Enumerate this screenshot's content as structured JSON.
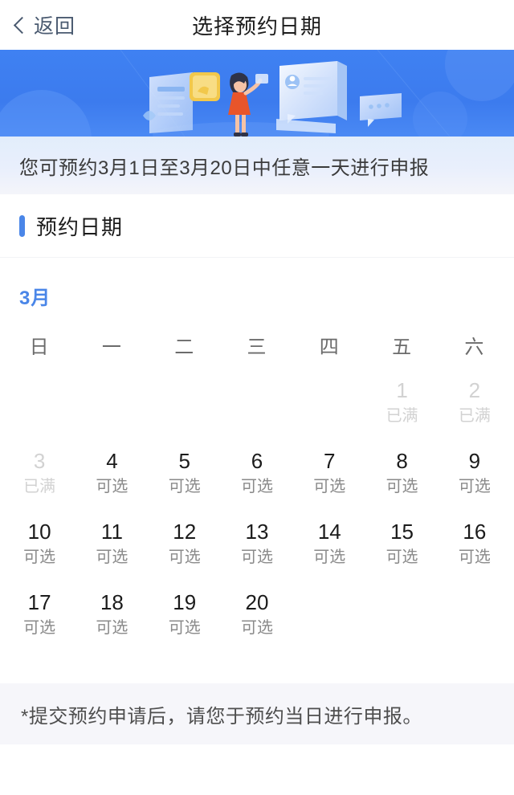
{
  "nav": {
    "back_label": "返回",
    "title": "选择预约日期"
  },
  "banner": {
    "alt": "预约申报插画"
  },
  "info": {
    "text": "您可预约3月1日至3月20日中任意一天进行申报"
  },
  "section": {
    "title": "预约日期"
  },
  "calendar": {
    "month_label": "3月",
    "weekdays": [
      "日",
      "一",
      "二",
      "三",
      "四",
      "五",
      "六"
    ],
    "leading_blanks": 5,
    "status_available": "可选",
    "status_full": "已满",
    "days": [
      {
        "day": "1",
        "status": "已满",
        "state": "full"
      },
      {
        "day": "2",
        "status": "已满",
        "state": "full"
      },
      {
        "day": "3",
        "status": "已满",
        "state": "full"
      },
      {
        "day": "4",
        "status": "可选",
        "state": "available"
      },
      {
        "day": "5",
        "status": "可选",
        "state": "available"
      },
      {
        "day": "6",
        "status": "可选",
        "state": "available"
      },
      {
        "day": "7",
        "status": "可选",
        "state": "available"
      },
      {
        "day": "8",
        "status": "可选",
        "state": "available"
      },
      {
        "day": "9",
        "status": "可选",
        "state": "available"
      },
      {
        "day": "10",
        "status": "可选",
        "state": "available"
      },
      {
        "day": "11",
        "status": "可选",
        "state": "available"
      },
      {
        "day": "12",
        "status": "可选",
        "state": "available"
      },
      {
        "day": "13",
        "status": "可选",
        "state": "available"
      },
      {
        "day": "14",
        "status": "可选",
        "state": "available"
      },
      {
        "day": "15",
        "status": "可选",
        "state": "available"
      },
      {
        "day": "16",
        "status": "可选",
        "state": "available"
      },
      {
        "day": "17",
        "status": "可选",
        "state": "available"
      },
      {
        "day": "18",
        "status": "可选",
        "state": "available"
      },
      {
        "day": "19",
        "status": "可选",
        "state": "available"
      },
      {
        "day": "20",
        "status": "可选",
        "state": "available"
      }
    ]
  },
  "footer": {
    "note": "*提交预约申请后，请您于预约当日进行申报。"
  },
  "colors": {
    "brand_blue": "#4a86e8",
    "banner_blue": "#3f81f2",
    "info_band": "#e2edfb",
    "text_primary": "#1b1b1b",
    "text_muted": "#8a8a8a",
    "text_disabled": "#d2d2d2",
    "footer_bg": "#f6f6fa",
    "folder_yellow": "#f2c84b",
    "dress_orange": "#ea5b2b"
  }
}
